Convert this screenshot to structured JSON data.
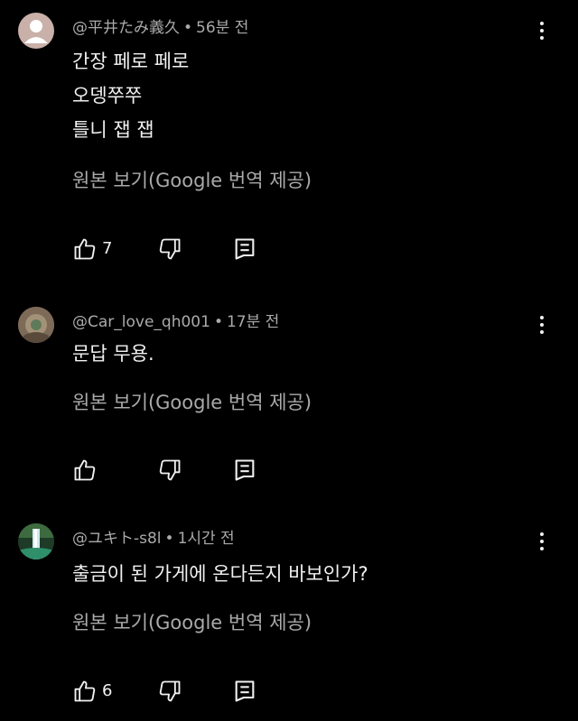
{
  "comments": [
    {
      "author": "@平井たみ義久",
      "separator": "•",
      "time": "56분 전",
      "avatar": "default-person",
      "lines": [
        "간장 페로 페로",
        "오뎅쭈쭈",
        "틀니 잽 잽"
      ],
      "translate_label": "원본 보기(Google 번역 제공)",
      "likes": "7"
    },
    {
      "author": "@Car_love_qh001",
      "separator": "•",
      "time": "17분 전",
      "avatar": "photo",
      "lines": [
        "문답 무용."
      ],
      "translate_label": "원본 보기(Google 번역 제공)",
      "likes": ""
    },
    {
      "author": "@ユキト-s8l",
      "separator": "•",
      "time": "1시간 전",
      "avatar": "photo-waterfall",
      "lines": [
        "출금이 된 가게에 온다든지 바보인가?"
      ],
      "translate_label": "원본 보기(Google 번역 제공)",
      "likes": "6"
    }
  ],
  "icons": {
    "like": "thumbs-up-icon",
    "dislike": "thumbs-down-icon",
    "reply": "reply-icon",
    "more": "more-vert-icon"
  },
  "colors": {
    "background": "#000000",
    "text": "#f1f1f1",
    "secondary": "#aaaaaa"
  }
}
